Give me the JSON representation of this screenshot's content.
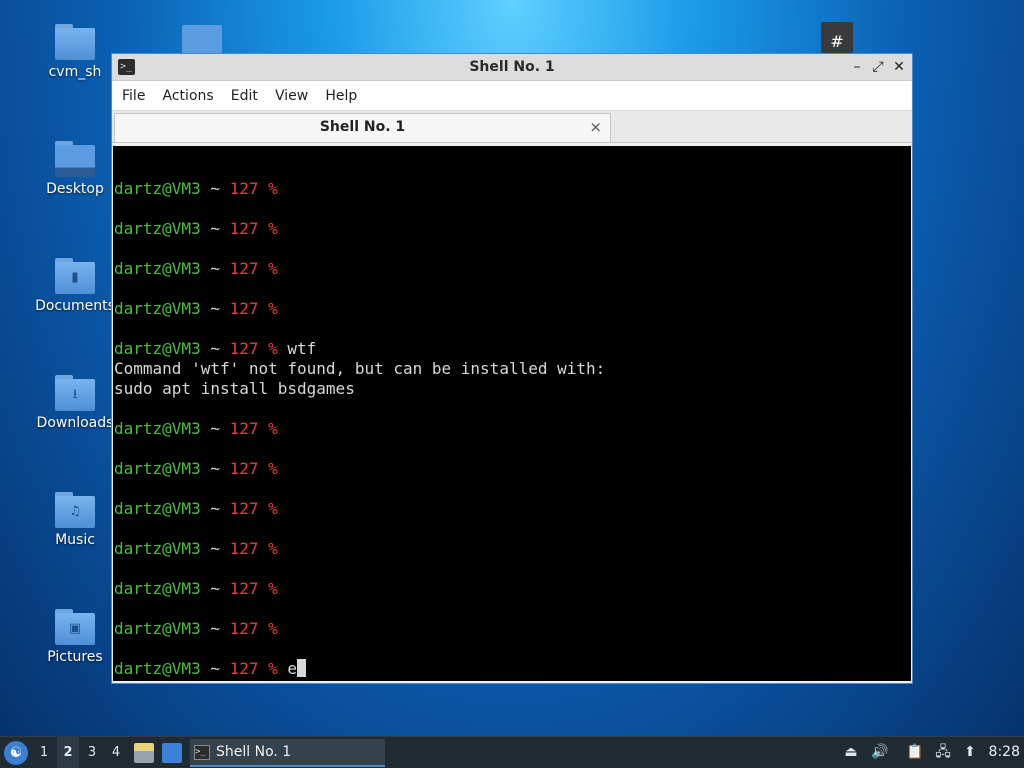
{
  "desktop": {
    "icons": [
      {
        "label": "cvm_sh",
        "glyph": ""
      },
      {
        "label": "Desktop",
        "glyph": ""
      },
      {
        "label": "Documents",
        "glyph": "▮"
      },
      {
        "label": "Downloads",
        "glyph": "⭳"
      },
      {
        "label": "Music",
        "glyph": "♫"
      },
      {
        "label": "Pictures",
        "glyph": "▣"
      }
    ],
    "partial_icon_glyph": "#"
  },
  "window": {
    "title": "Shell No. 1",
    "app_icon": ">_",
    "controls": {
      "minimize": "–",
      "maximize": "⤢",
      "close": "✕"
    },
    "menu": [
      "File",
      "Actions",
      "Edit",
      "View",
      "Help"
    ],
    "tab": {
      "label": "Shell No. 1",
      "close": "×"
    }
  },
  "terminal": {
    "user_host": "dartz@VM3",
    "tilde": " ~ ",
    "code": "127",
    "prompt_char": " %",
    "lines": [
      {
        "type": "blank"
      },
      {
        "type": "prompt",
        "cmd": ""
      },
      {
        "type": "blank"
      },
      {
        "type": "prompt",
        "cmd": ""
      },
      {
        "type": "blank"
      },
      {
        "type": "prompt",
        "cmd": ""
      },
      {
        "type": "blank"
      },
      {
        "type": "prompt",
        "cmd": ""
      },
      {
        "type": "blank"
      },
      {
        "type": "prompt",
        "cmd": " wtf"
      },
      {
        "type": "output",
        "text": "Command 'wtf' not found, but can be installed with:"
      },
      {
        "type": "output",
        "text": "sudo apt install bsdgames"
      },
      {
        "type": "blank"
      },
      {
        "type": "prompt",
        "cmd": ""
      },
      {
        "type": "blank"
      },
      {
        "type": "prompt",
        "cmd": ""
      },
      {
        "type": "blank"
      },
      {
        "type": "prompt",
        "cmd": ""
      },
      {
        "type": "blank"
      },
      {
        "type": "prompt",
        "cmd": ""
      },
      {
        "type": "blank"
      },
      {
        "type": "prompt",
        "cmd": ""
      },
      {
        "type": "blank"
      },
      {
        "type": "prompt",
        "cmd": ""
      },
      {
        "type": "blank"
      },
      {
        "type": "prompt",
        "cmd": " e",
        "cursor": true
      }
    ]
  },
  "taskbar": {
    "start_icon": "☯",
    "workspaces": [
      "1",
      "2",
      "3",
      "4"
    ],
    "active_workspace": "2",
    "task_label": "Shell No. 1",
    "task_icon": ">_",
    "tray": {
      "eject": "⏏",
      "volume": "🔊",
      "clipboard": "📋",
      "network": "🖧",
      "updates": "⬆"
    },
    "clock": "8:28"
  }
}
